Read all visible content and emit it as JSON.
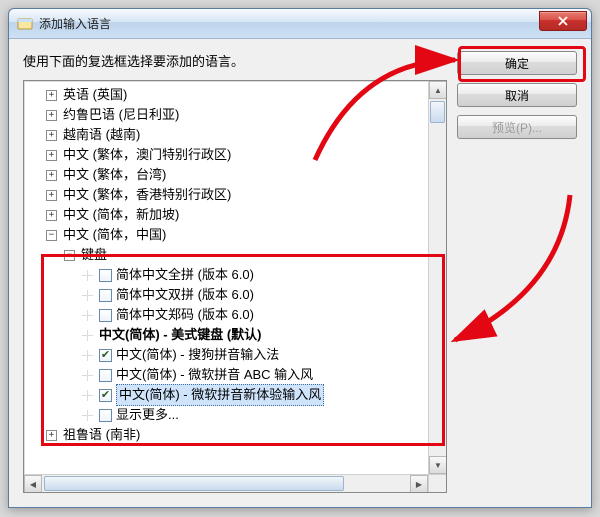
{
  "window": {
    "title": "添加输入语言",
    "closeAria": "关闭"
  },
  "instruction": "使用下面的复选框选择要添加的语言。",
  "buttons": {
    "ok": "确定",
    "cancel": "取消",
    "preview": "预览(P)..."
  },
  "tree": {
    "topLevel": [
      {
        "label": "英语 (英国)",
        "expander": "+"
      },
      {
        "label": "约鲁巴语 (尼日利亚)",
        "expander": "+"
      },
      {
        "label": "越南语 (越南)",
        "expander": "+"
      },
      {
        "label": "中文 (繁体，澳门特别行政区)",
        "expander": "+"
      },
      {
        "label": "中文 (繁体，台湾)",
        "expander": "+"
      },
      {
        "label": "中文 (繁体，香港特别行政区)",
        "expander": "+"
      },
      {
        "label": "中文 (简体，新加坡)",
        "expander": "+"
      },
      {
        "label": "中文 (简体，中国)",
        "expander": "−"
      }
    ],
    "keyboardGroup": {
      "label": "键盘",
      "expander": "−",
      "items": [
        {
          "label": "简体中文全拼 (版本 6.0)",
          "checked": false
        },
        {
          "label": "简体中文双拼 (版本 6.0)",
          "checked": false
        },
        {
          "label": "简体中文郑码 (版本 6.0)",
          "checked": false
        },
        {
          "label": "中文(简体) - 美式键盘 (默认)",
          "bold": true,
          "plain": true
        },
        {
          "label": "中文(简体) - 搜狗拼音输入法",
          "checked": true
        },
        {
          "label": "中文(简体) - 微软拼音 ABC 输入风",
          "checked": false
        },
        {
          "label": "中文(简体) - 微软拼音新体验输入风",
          "checked": true,
          "selected": true
        },
        {
          "label": "显示更多...",
          "checked": false
        }
      ]
    },
    "after": [
      {
        "label": "祖鲁语 (南非)",
        "expander": "+"
      }
    ]
  }
}
